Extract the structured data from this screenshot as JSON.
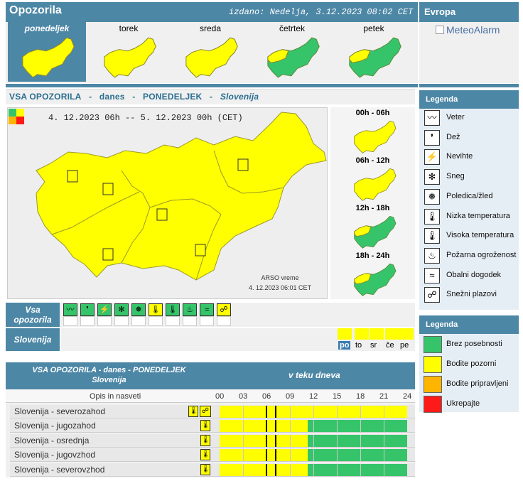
{
  "header": {
    "title": "Opozorila",
    "issued": "izdano: Nedelja, 3.12.2023 08:02 CET"
  },
  "europe": {
    "title": "Evropa",
    "link": "MeteoAlarm"
  },
  "days": [
    {
      "label": "ponedeljek",
      "selected": true,
      "level": "yellow"
    },
    {
      "label": "torek",
      "selected": false,
      "level": "yellow"
    },
    {
      "label": "sreda",
      "selected": false,
      "level": "yellow"
    },
    {
      "label": "četrtek",
      "selected": false,
      "level": "mixed"
    },
    {
      "label": "petek",
      "selected": false,
      "level": "mixed"
    }
  ],
  "section": {
    "p1": "VSA OPOZORILA",
    "p2": "-",
    "p3": "danes",
    "p4": "-",
    "p5": "PONEDELJEK",
    "p6": "-",
    "p7": "Slovenija"
  },
  "map": {
    "period": "4. 12.2023  06h  --  5. 12.2023  00h    (CET)",
    "credit1": "ARSO vreme",
    "credit2": "4. 12.2023  06:01 CET"
  },
  "time_slots": [
    "00h - 06h",
    "06h - 12h",
    "12h - 18h",
    "18h - 24h"
  ],
  "warn_row": {
    "label": "Vsa opozorila",
    "slo_label": "Slovenija"
  },
  "day_abbrev": [
    "po",
    "to",
    "sr",
    "če",
    "pe"
  ],
  "table": {
    "title": "VSA OPOZORILA - danes - PONEDELJEK",
    "subtitle": "Slovenija",
    "during_day": "v teku dneva",
    "desc_header": "Opis in nasveti",
    "hours": [
      "00",
      "03",
      "06",
      "09",
      "12",
      "15",
      "18",
      "21",
      "24"
    ],
    "rows": [
      {
        "name": "Slovenija - severozahod"
      },
      {
        "name": "Slovenija - jugozahod"
      },
      {
        "name": "Slovenija - osrednja"
      },
      {
        "name": "Slovenija - jugovzhod"
      },
      {
        "name": "Slovenija - severovzhod"
      }
    ]
  },
  "legend_icons": {
    "title": "Legenda",
    "items": [
      "Veter",
      "Dež",
      "Nevihte",
      "Sneg",
      "Poledica/žled",
      "Nizka temperatura",
      "Visoka temperatura",
      "Požarna ogroženost",
      "Obalni dogodek",
      "Snežni plazovi"
    ]
  },
  "legend_colors": {
    "title": "Legenda",
    "items": [
      {
        "label": "Brez posebnosti",
        "color": "#36c46a"
      },
      {
        "label": "Bodite pozorni",
        "color": "#ffff00"
      },
      {
        "label": "Bodite pripravljeni",
        "color": "#ffb400"
      },
      {
        "label": "Ukrepajte",
        "color": "#ff1a1a"
      }
    ]
  }
}
